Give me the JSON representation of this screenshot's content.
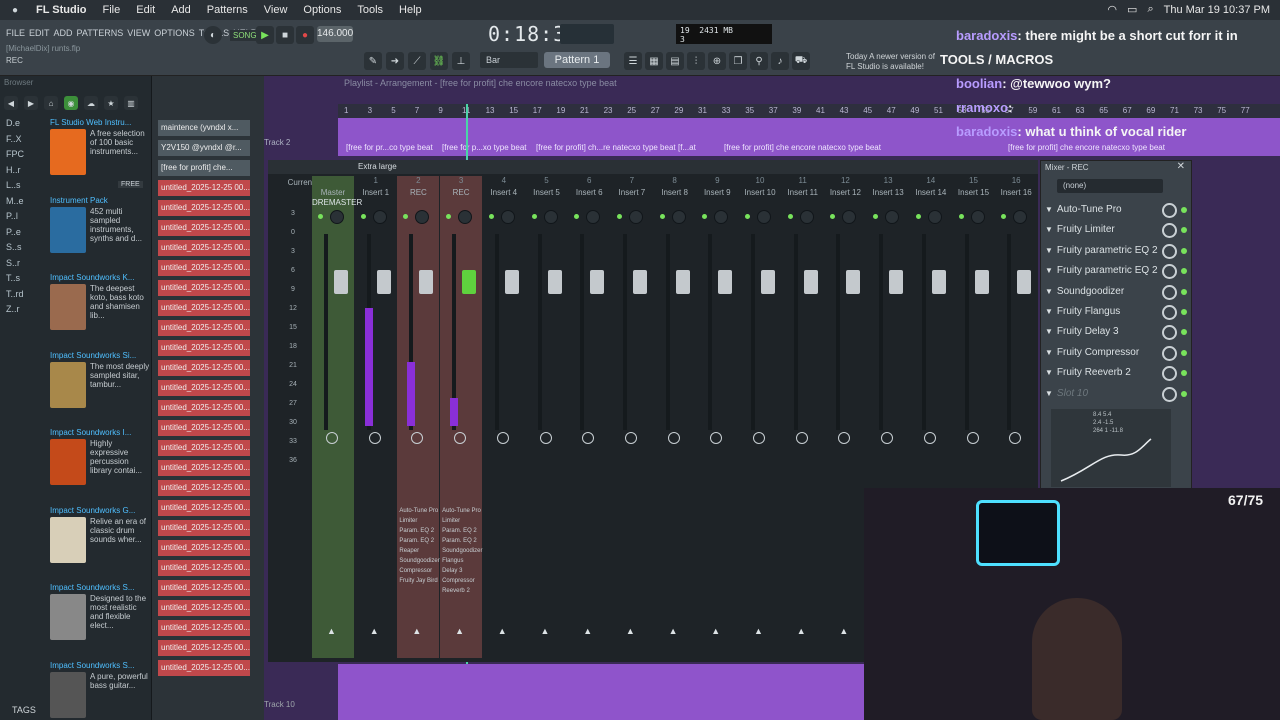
{
  "mac_menu": {
    "app": "FL Studio",
    "items": [
      "File",
      "Edit",
      "Add",
      "Patterns",
      "View",
      "Options",
      "Tools",
      "Help"
    ],
    "datetime": "Thu Mar 19  10:37 PM"
  },
  "fl_menu": [
    "FILE",
    "EDIT",
    "ADD",
    "PATTERNS",
    "VIEW",
    "OPTIONS",
    "TOOLS",
    "HELP"
  ],
  "project": {
    "name": "[MichaelDix] runts.flp",
    "mode": "REC"
  },
  "transport": {
    "song_label": "SONG",
    "tempo": "146.000",
    "time": "0:18:31",
    "snap": "Bar",
    "pattern": "Pattern 1"
  },
  "cpu": {
    "value": "19",
    "mem": "2431 MB",
    "vox": "3"
  },
  "news": {
    "line1": "Today  A newer version of",
    "line2": "FL Studio is available!"
  },
  "browser": {
    "title": "Browser",
    "items": [
      "D.e",
      "F..X",
      "FPC",
      "H..r",
      "L..s",
      "M..e",
      "P..l",
      "P..e",
      "S..s",
      "S..r",
      "T..s",
      "T..rd",
      "Z..r"
    ],
    "libs": [
      {
        "title": "FL Studio Web Instru...",
        "desc": "A free selection of 100 basic instruments..."
      },
      {
        "title": "Instrument Pack",
        "desc": "452 multi sampled instruments, synths and d..."
      },
      {
        "title": "Impact Soundworks K...",
        "desc": "The deepest koto, bass koto and shamisen lib..."
      },
      {
        "title": "Impact Soundworks Si...",
        "desc": "The most deeply sampled sitar, tambur..."
      },
      {
        "title": "Impact Soundworks I...",
        "desc": "Highly expressive percussion library contai..."
      },
      {
        "title": "Impact Soundworks G...",
        "desc": "Relive an era of classic drum sounds wher..."
      },
      {
        "title": "Impact Soundworks S...",
        "desc": "Designed to the most realistic and flexible elect..."
      },
      {
        "title": "Impact Soundworks S...",
        "desc": "A pure, powerful bass guitar..."
      }
    ],
    "free_badge": "FREE",
    "tags": "TAGS"
  },
  "channels": [
    "maintence (yvndxl x...",
    "Y2V150 @yvndxl @r...",
    "[free for profit] che...",
    "untitled_2025-12-25 00...",
    "untitled_2025-12-25 00...",
    "untitled_2025-12-25 00...",
    "untitled_2025-12-25 00...",
    "untitled_2025-12-25 00...",
    "untitled_2025-12-25 00...",
    "untitled_2025-12-25 00...",
    "untitled_2025-12-25 00...",
    "untitled_2025-12-25 00...",
    "untitled_2025-12-25 00...",
    "untitled_2025-12-25 00...",
    "untitled_2025-12-25 00...",
    "untitled_2025-12-25 00...",
    "untitled_2025-12-25 00...",
    "untitled_2025-12-25 00...",
    "untitled_2025-12-25 00...",
    "untitled_2025-12-25 00...",
    "untitled_2025-12-25 00...",
    "untitled_2025-12-25 00...",
    "untitled_2025-12-25 00...",
    "untitled_2025-12-25 00...",
    "untitled_2025-12-25 00...",
    "untitled_2025-12-25 00...",
    "untitled_2025-12-25 00...",
    "untitled_2025-12-25 00..."
  ],
  "playlist": {
    "title": "Playlist - Arrangement - [free for profit] che encore natecxo type beat",
    "ruler": [
      "1",
      "3",
      "5",
      "7",
      "9",
      "11",
      "13",
      "15",
      "17",
      "19",
      "21",
      "23",
      "25",
      "27",
      "29",
      "31",
      "33",
      "35",
      "37",
      "39",
      "41",
      "43",
      "45",
      "47",
      "49",
      "51",
      "53",
      "55",
      "57",
      "59",
      "61",
      "63",
      "65",
      "67",
      "69",
      "71",
      "73",
      "75",
      "77"
    ],
    "track2": "Track 2",
    "track10": "Track 10",
    "clips": [
      "[free for pr...co type beat",
      "[free for p...xo type beat",
      "[free for profit] ch...re natecxo type beat",
      "[f...at",
      "[free for profit] che encore natecxo type beat",
      "[free for profit] che encore natecxo type beat"
    ]
  },
  "mixer": {
    "size": "Extra large",
    "title": "Mixer - REC",
    "scale": [
      "3",
      "0",
      "3",
      "6",
      "9",
      "12",
      "15",
      "18",
      "21",
      "24",
      "27",
      "30",
      "33",
      "36"
    ],
    "strips": [
      {
        "num": "",
        "name": "Current",
        "sub": ""
      },
      {
        "num": "",
        "name": "Master",
        "sub": "DREMASTER"
      },
      {
        "num": "1",
        "name": "Insert 1",
        "sub": ""
      },
      {
        "num": "2",
        "name": "REC",
        "sub": ""
      },
      {
        "num": "3",
        "name": "REC",
        "sub": ""
      },
      {
        "num": "4",
        "name": "Insert 4",
        "sub": ""
      },
      {
        "num": "5",
        "name": "Insert 5",
        "sub": ""
      },
      {
        "num": "6",
        "name": "Insert 6",
        "sub": ""
      },
      {
        "num": "7",
        "name": "Insert 7",
        "sub": ""
      },
      {
        "num": "8",
        "name": "Insert 8",
        "sub": ""
      },
      {
        "num": "9",
        "name": "Insert 9",
        "sub": ""
      },
      {
        "num": "10",
        "name": "Insert 10",
        "sub": ""
      },
      {
        "num": "11",
        "name": "Insert 11",
        "sub": ""
      },
      {
        "num": "12",
        "name": "Insert 12",
        "sub": ""
      },
      {
        "num": "13",
        "name": "Insert 13",
        "sub": ""
      },
      {
        "num": "14",
        "name": "Insert 14",
        "sub": ""
      },
      {
        "num": "15",
        "name": "Insert 15",
        "sub": ""
      },
      {
        "num": "16",
        "name": "Insert 16",
        "sub": ""
      }
    ],
    "fx_rec2": [
      "Auto-Tune Pro",
      "Limiter",
      "Param. EQ 2",
      "Param. EQ 2",
      "Reaper",
      "Soundgoodizer",
      "Compressor",
      "Fruity Jay Bird"
    ],
    "fx_rec3": [
      "Auto-Tune Pro",
      "Limiter",
      "Param. EQ 2",
      "Param. EQ 2",
      "Soundgoodizer",
      "Flangus",
      "Delay 3",
      "Compressor",
      "Reeverb 2"
    ]
  },
  "fx_panel": {
    "input": "(none)",
    "slots": [
      "Auto-Tune Pro",
      "Fruity Limiter",
      "Fruity parametric EQ 2",
      "Fruity parametric EQ 2",
      "Soundgoodizer",
      "Fruity Flangus",
      "Fruity Delay 3",
      "Fruity Compressor",
      "Fruity Reeverb 2",
      "Slot 10"
    ],
    "eq_readout": [
      "8.4  5.4",
      "2.4  -1.5",
      "264  1  -11.8"
    ]
  },
  "chat": [
    {
      "user": "baradoxis",
      "msg": "there might be a short cut forr it in"
    },
    {
      "user": "",
      "msg": "TOOLS / MACROS"
    },
    {
      "user": "boolian",
      "msg": "@tewwoo wym?"
    },
    {
      "user": "rramoxo",
      "msg": ""
    },
    {
      "user": "baradoxis",
      "msg": "what u think of vocal rider"
    }
  ],
  "overlay": {
    "counter": "67/75"
  },
  "colors": {
    "accent_green": "#78e35c",
    "clip_purple": "#8e55ca",
    "chat_user_purple": "#b89cff",
    "channel_red": "#c0484b"
  }
}
